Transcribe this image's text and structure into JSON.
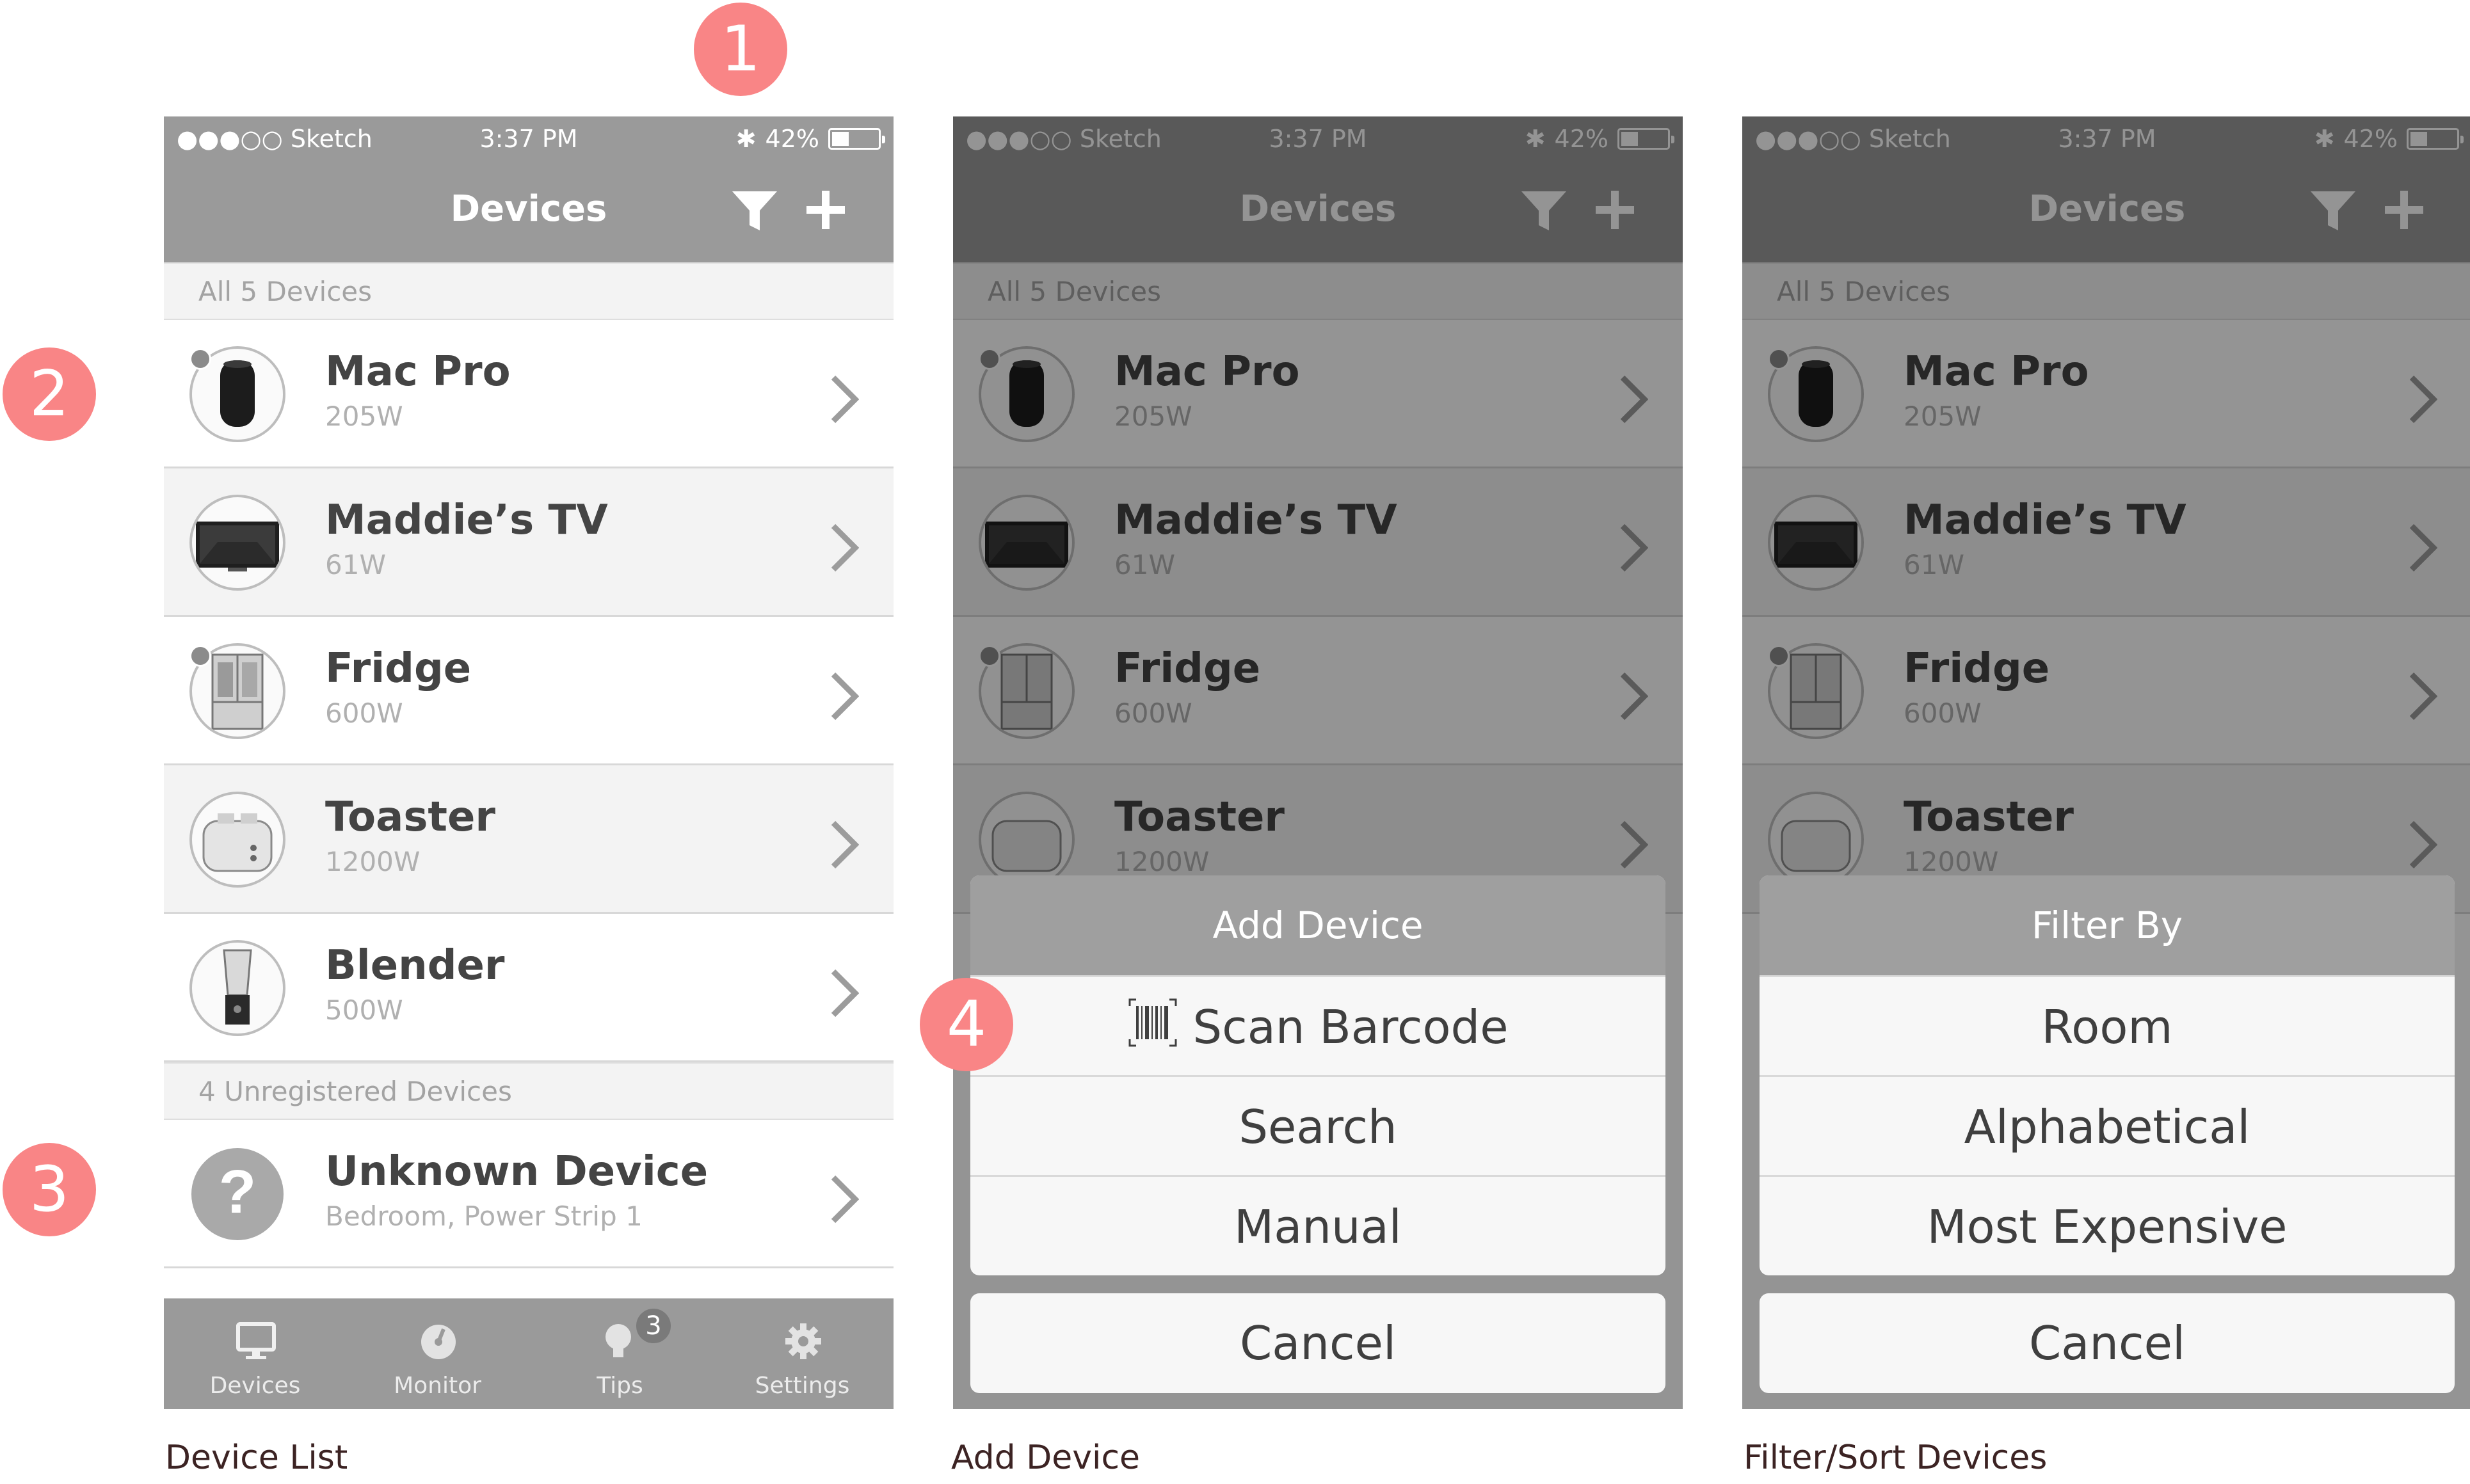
{
  "status_bar": {
    "carrier": "●●●○○ Sketch",
    "time": "3:37 PM",
    "battery": "42%"
  },
  "nav": {
    "title": "Devices"
  },
  "sections": {
    "registered": "All 5 Devices",
    "unregistered": "4 Unregistered Devices"
  },
  "devices": [
    {
      "name": "Mac Pro",
      "power": "205W",
      "icon": "mac-pro-icon"
    },
    {
      "name": "Maddie’s TV",
      "power": "61W",
      "icon": "tv-icon"
    },
    {
      "name": "Fridge",
      "power": "600W",
      "icon": "fridge-icon"
    },
    {
      "name": "Toaster",
      "power": "1200W",
      "icon": "toaster-icon"
    },
    {
      "name": "Blender",
      "power": "500W",
      "icon": "blender-icon"
    }
  ],
  "unregistered_devices": [
    {
      "name": "Unknown Device",
      "location": "Bedroom, Power Strip 1",
      "icon": "question-icon"
    }
  ],
  "tabs": [
    {
      "label": "Devices",
      "icon": "monitor-icon"
    },
    {
      "label": "Monitor",
      "icon": "gauge-icon"
    },
    {
      "label": "Tips",
      "icon": "lightbulb-icon",
      "badge": "3"
    },
    {
      "label": "Settings",
      "icon": "gear-icon"
    }
  ],
  "add_sheet": {
    "title": "Add Device",
    "items": [
      "Scan Barcode",
      "Search",
      "Manual"
    ],
    "cancel": "Cancel"
  },
  "filter_sheet": {
    "title": "Filter By",
    "items": [
      "Room",
      "Alphabetical",
      "Most Expensive"
    ],
    "cancel": "Cancel"
  },
  "callouts": [
    "1",
    "2",
    "3",
    "4"
  ],
  "captions": [
    "Device List",
    "Add Device",
    "Filter/Sort Devices"
  ],
  "colors": {
    "callout": "#f98586",
    "header_gray": "#9a9a9a",
    "overlay": "rgba(0,0,0,0.42)"
  }
}
